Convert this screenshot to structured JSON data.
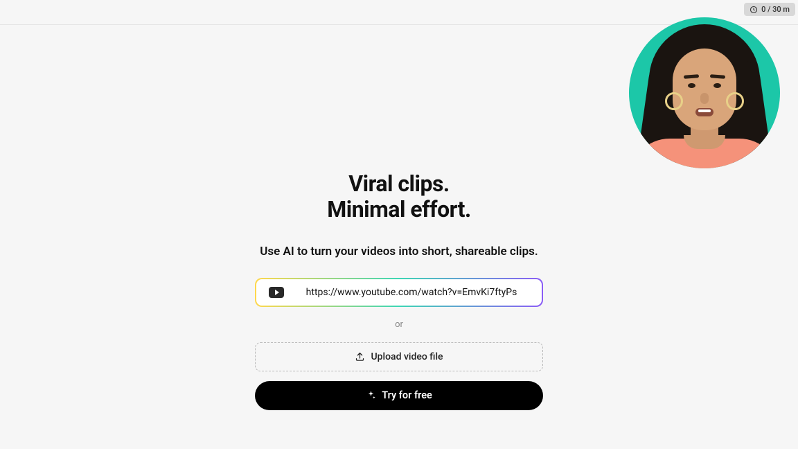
{
  "usage": {
    "text": "0 / 30 m"
  },
  "hero": {
    "headline_line1": "Viral clips.",
    "headline_line2": "Minimal effort.",
    "subhead": "Use AI to turn your videos into short, shareable clips."
  },
  "form": {
    "url_value": "https://www.youtube.com/watch?v=EmvKi7ftyPs",
    "or_label": "or",
    "upload_label": "Upload video file",
    "cta_label": "Try for free"
  }
}
